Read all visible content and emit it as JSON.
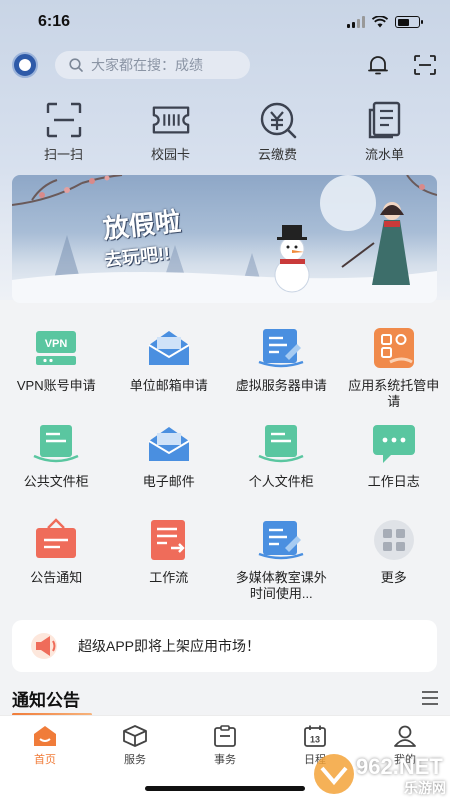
{
  "status": {
    "time": "6:16"
  },
  "search": {
    "placeholder": "大家都在搜：成绩"
  },
  "quick_actions": [
    {
      "label": "扫一扫",
      "icon": "scan-icon"
    },
    {
      "label": "校园卡",
      "icon": "campus-card-icon"
    },
    {
      "label": "云缴费",
      "icon": "cloud-payment-icon"
    },
    {
      "label": "流水单",
      "icon": "statement-icon"
    }
  ],
  "banner": {
    "text1": "放假啦",
    "text2": "去玩吧!!"
  },
  "apps": [
    {
      "label": "VPN账号申请",
      "icon": "vpn-icon",
      "color": "#5ac6a0"
    },
    {
      "label": "单位邮箱申请",
      "icon": "mail-apply-icon",
      "color": "#4a8fe0"
    },
    {
      "label": "虚拟服务器申请",
      "icon": "virtual-server-icon",
      "color": "#4a8fe0"
    },
    {
      "label": "应用系统托管申请",
      "icon": "app-hosting-icon",
      "color": "#f08a4b"
    },
    {
      "label": "公共文件柜",
      "icon": "public-file-icon",
      "color": "#5ac6a0"
    },
    {
      "label": "电子邮件",
      "icon": "email-icon",
      "color": "#4a8fe0"
    },
    {
      "label": "个人文件柜",
      "icon": "personal-file-icon",
      "color": "#5ac6a0"
    },
    {
      "label": "工作日志",
      "icon": "work-log-icon",
      "color": "#5ac6a0"
    },
    {
      "label": "公告通知",
      "icon": "announcement-icon",
      "color": "#ef6c5a"
    },
    {
      "label": "工作流",
      "icon": "workflow-icon",
      "color": "#ef6c5a"
    },
    {
      "label": "多媒体教室课外时间使用...",
      "icon": "multimedia-classroom-icon",
      "color": "#4a8fe0"
    },
    {
      "label": "更多",
      "icon": "more-icon",
      "color": "#c4c8cf"
    }
  ],
  "notice": {
    "text": "超级APP即将上架应用市场！"
  },
  "section": {
    "title": "通知公告"
  },
  "tabs": [
    {
      "label": "首页",
      "icon": "home-icon",
      "active": true
    },
    {
      "label": "服务",
      "icon": "service-icon",
      "active": false
    },
    {
      "label": "事务",
      "icon": "affairs-icon",
      "active": false
    },
    {
      "label": "日程",
      "icon": "calendar-icon",
      "active": false,
      "badge": "13"
    },
    {
      "label": "我的",
      "icon": "profile-icon",
      "active": false
    }
  ],
  "watermark": {
    "brand": "962.NET",
    "sub": "乐游网"
  },
  "colors": {
    "accent": "#f07c3a",
    "green": "#5ac6a0",
    "blue": "#4a8fe0",
    "red": "#ef6c5a"
  }
}
